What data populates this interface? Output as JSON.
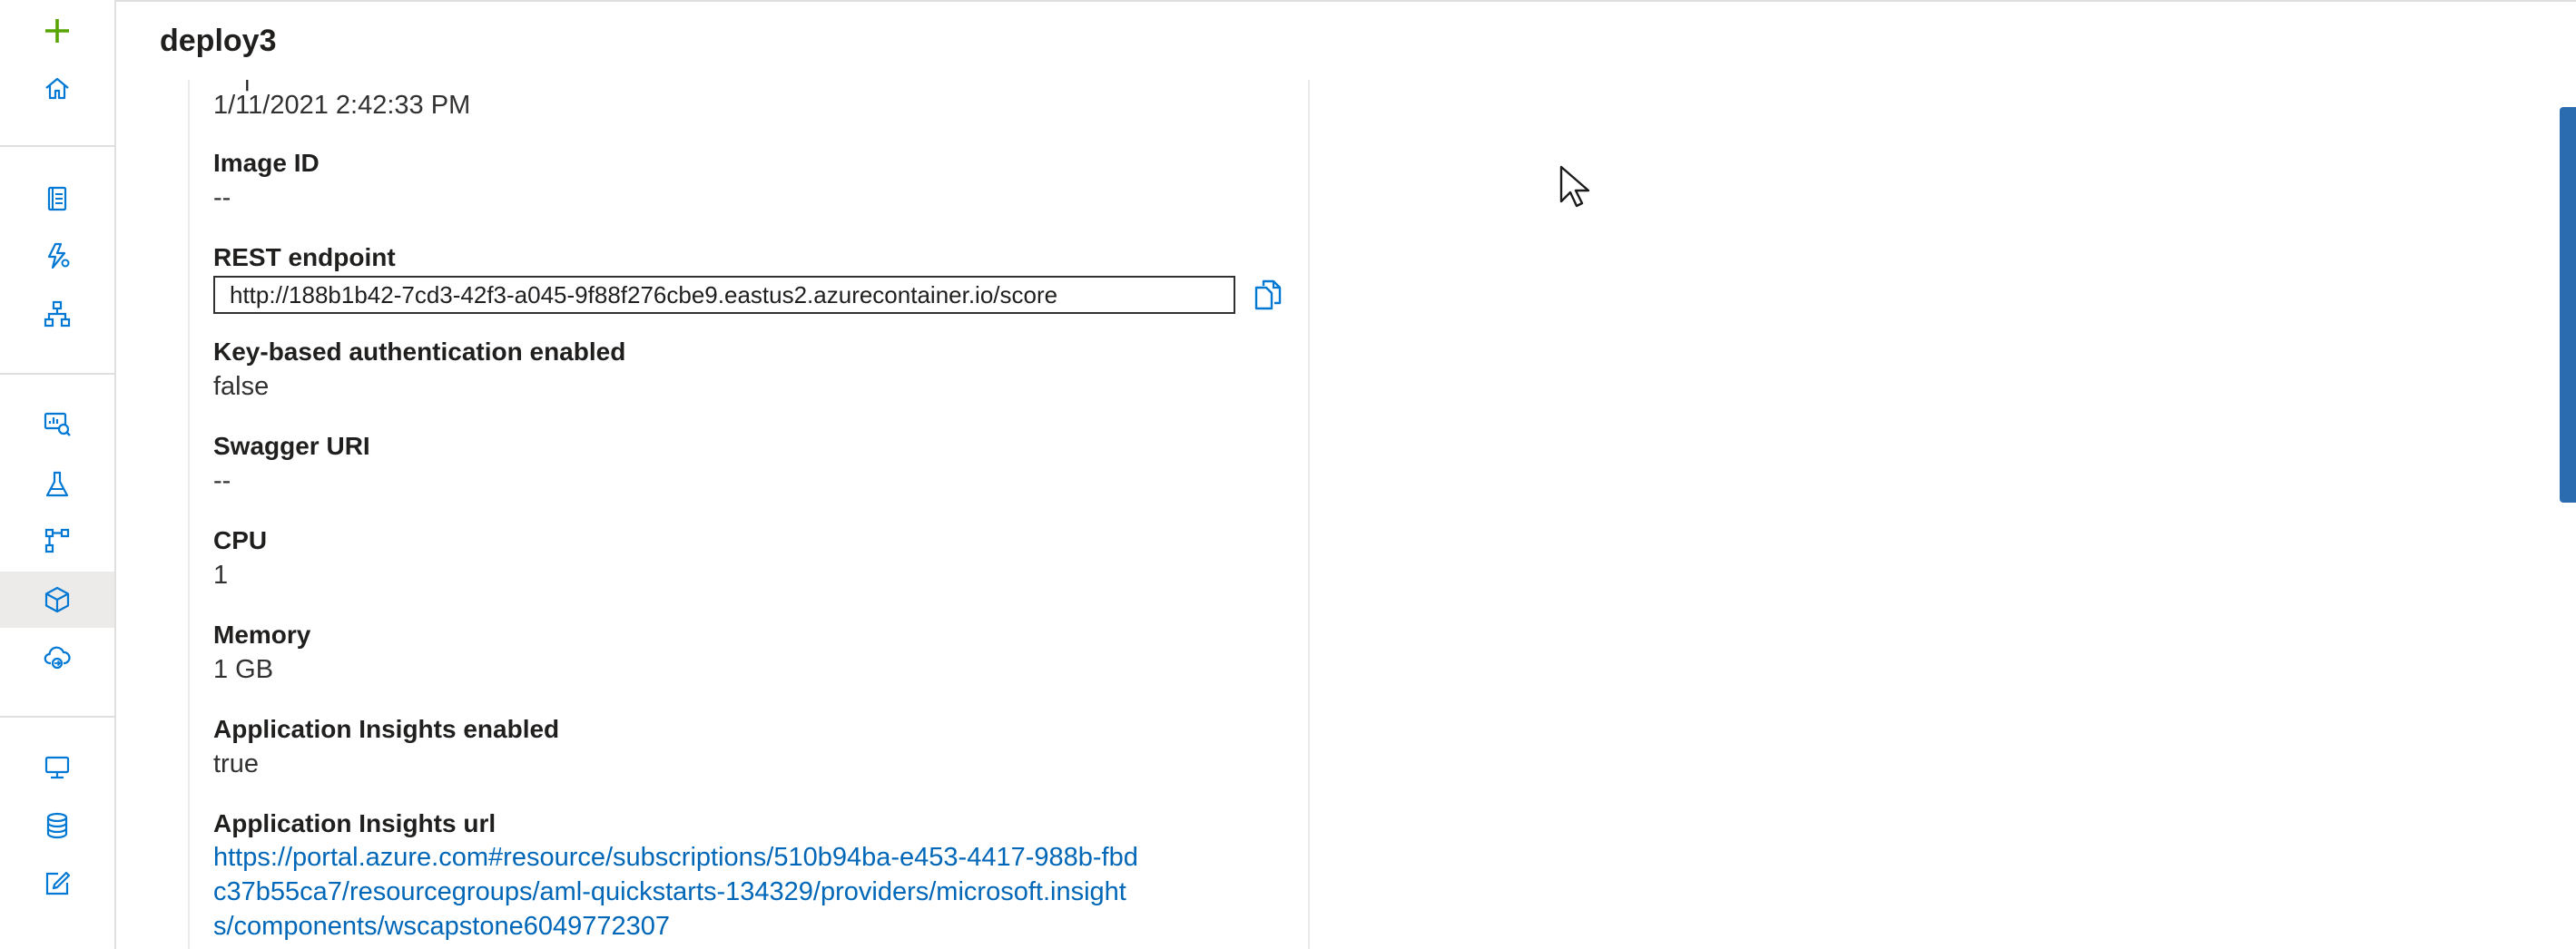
{
  "header": {
    "title": "deploy3"
  },
  "nav": {
    "items": [
      {
        "icon": "plus-icon"
      },
      {
        "icon": "home-icon"
      },
      {
        "icon": "notebook-icon"
      },
      {
        "icon": "automl-icon"
      },
      {
        "icon": "designer-icon"
      },
      {
        "icon": "datasets-icon"
      },
      {
        "icon": "experiments-icon"
      },
      {
        "icon": "pipelines-icon"
      },
      {
        "icon": "models-icon",
        "selected": true
      },
      {
        "icon": "endpoints-icon"
      },
      {
        "icon": "compute-icon"
      },
      {
        "icon": "datastores-icon"
      },
      {
        "icon": "labeling-icon"
      }
    ]
  },
  "details": {
    "created_on": "1/11/2021 2:42:33 PM",
    "image_id": {
      "label": "Image ID",
      "value": "--"
    },
    "rest_endpoint": {
      "label": "REST endpoint",
      "value": "http://188b1b42-7cd3-42f3-a045-9f88f276cbe9.eastus2.azurecontainer.io/score"
    },
    "key_auth": {
      "label": "Key-based authentication enabled",
      "value": "false"
    },
    "swagger_uri": {
      "label": "Swagger URI",
      "value": "--"
    },
    "cpu": {
      "label": "CPU",
      "value": "1"
    },
    "memory": {
      "label": "Memory",
      "value": "1 GB"
    },
    "app_insights_enabled": {
      "label": "Application Insights enabled",
      "value": "true"
    },
    "app_insights_url": {
      "label": "Application Insights url",
      "lines": [
        "https://portal.azure.com#resource/subscriptions/510b94ba-e453-4417-988b-fbd",
        "c37b55ca7/resourcegroups/aml-quickstarts-134329/providers/microsoft.insight",
        "s/components/wscapstone6049772307"
      ]
    }
  },
  "colors": {
    "accent": "#0078d4",
    "link": "#0067b8",
    "plus": "#57a300",
    "selected_bg": "#edebe9"
  }
}
